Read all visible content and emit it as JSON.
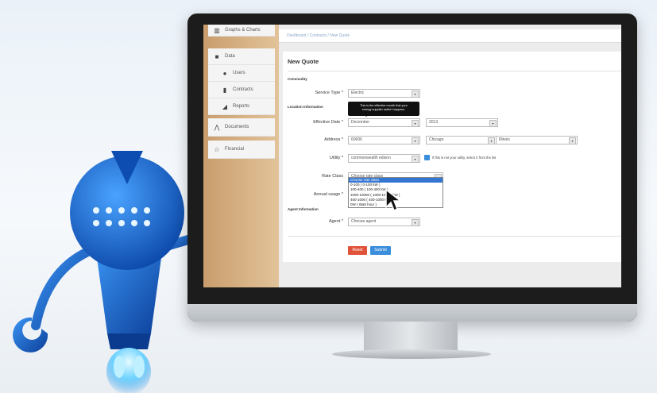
{
  "sidebar": {
    "items": [
      {
        "label": "Graphs & Charts",
        "icon": "chart-icon"
      },
      {
        "label": "Data",
        "icon": "folder-icon"
      },
      {
        "label": "Users",
        "icon": "user-icon"
      },
      {
        "label": "Contracts",
        "icon": "bookmark-icon"
      },
      {
        "label": "Reports",
        "icon": "report-icon"
      },
      {
        "label": "Documents",
        "icon": "share-icon"
      },
      {
        "label": "Financial",
        "icon": "star-icon"
      }
    ]
  },
  "breadcrumb": {
    "home": "Dashboard",
    "contracts": "Contracts",
    "current": "New Quote"
  },
  "page_title": "New Quote",
  "sections": {
    "commodity": "Commodity",
    "location": "Location Information",
    "agent": "Agent Information"
  },
  "fields": {
    "service_type": {
      "label": "Service Type *",
      "value": "Electric"
    },
    "tooltip": {
      "line1": "This is the effective month that your",
      "line2": "energy supplier switch happens."
    },
    "effective_date": {
      "label": "Effective Date *",
      "month": "December",
      "year": "2013"
    },
    "address": {
      "label": "Address *",
      "zip": "60606",
      "city": "Chicago",
      "state": "Illinois"
    },
    "utility": {
      "label": "Utility *",
      "value": "commonwealth edison",
      "note": "If this is not your utility, select it from the list"
    },
    "rate_class": {
      "label": "Rate Class",
      "value": "Choose rate class"
    },
    "annual_usage": {
      "label": "Annual usage *"
    },
    "agent": {
      "label": "Agent *",
      "value": "Choose agent"
    }
  },
  "rate_options": [
    "Choose rate class",
    "0-100 ( 0-100 kW )",
    "100-400 ( 100-400 kW )",
    "1000-10000 ( 1000-10000 kW )",
    "400-1000 ( 400-1000 kW )",
    "0W ( Watt hour )"
  ],
  "buttons": {
    "reset": "Reset",
    "submit": "Submit"
  },
  "colors": {
    "accent": "#3a8edb",
    "reset": "#e0533b",
    "submit": "#3a8edb",
    "robot": "#1f6fd6"
  }
}
